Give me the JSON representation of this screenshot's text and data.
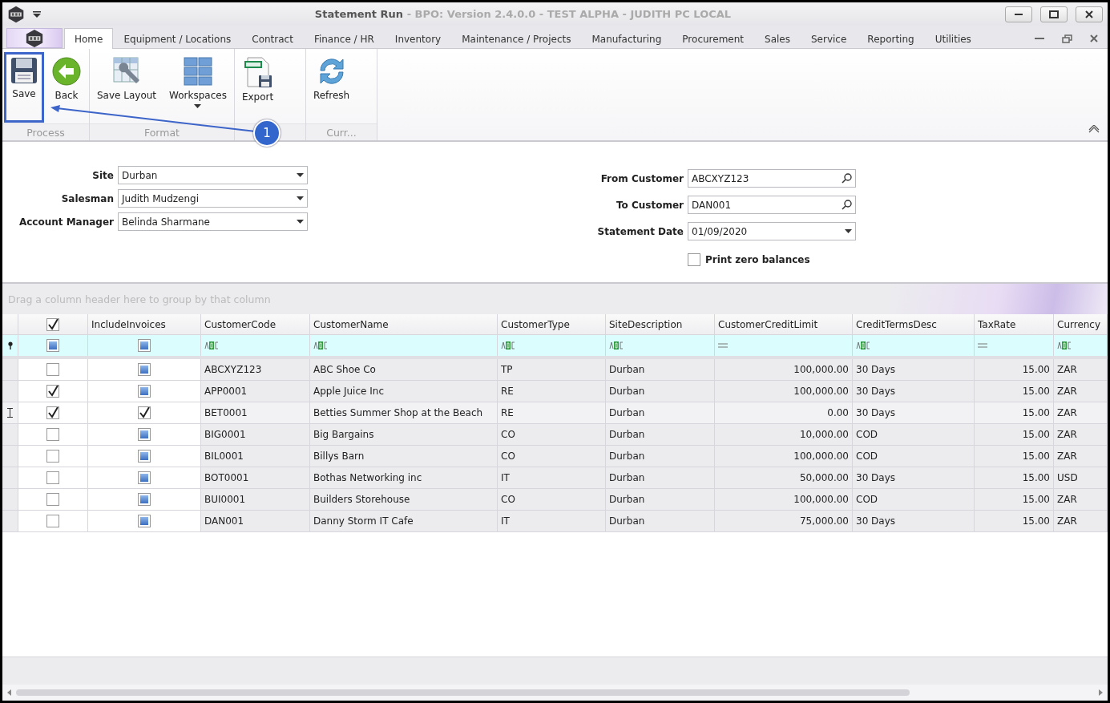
{
  "window": {
    "title": "Statement Run",
    "subtitle": " - BPO: Version 2.4.0.0 - TEST ALPHA - JUDITH PC LOCAL"
  },
  "tabs": [
    {
      "label": "Home",
      "selected": true
    },
    {
      "label": "Equipment / Locations",
      "selected": false
    },
    {
      "label": "Contract",
      "selected": false
    },
    {
      "label": "Finance / HR",
      "selected": false
    },
    {
      "label": "Inventory",
      "selected": false
    },
    {
      "label": "Maintenance / Projects",
      "selected": false
    },
    {
      "label": "Manufacturing",
      "selected": false
    },
    {
      "label": "Procurement",
      "selected": false
    },
    {
      "label": "Sales",
      "selected": false
    },
    {
      "label": "Service",
      "selected": false
    },
    {
      "label": "Reporting",
      "selected": false
    },
    {
      "label": "Utilities",
      "selected": false
    }
  ],
  "ribbon_groups": [
    {
      "label": "Process",
      "buttons": [
        {
          "label": "Save",
          "kind": "save",
          "highlighted": true
        },
        {
          "label": "Back",
          "kind": "back",
          "highlighted": false
        }
      ]
    },
    {
      "label": "Format",
      "buttons": [
        {
          "label": "Save Layout",
          "kind": "layout",
          "highlighted": false
        },
        {
          "label": "Workspaces",
          "kind": "workspaces",
          "highlighted": false,
          "dropdown": true
        }
      ]
    },
    {
      "buttons": [
        {
          "label": "Export",
          "kind": "export",
          "highlighted": false
        }
      ]
    },
    {
      "label": "Curr...",
      "buttons": [
        {
          "label": "Refresh",
          "kind": "refresh",
          "highlighted": false
        }
      ]
    }
  ],
  "callout": {
    "number": "1"
  },
  "filters_left": [
    {
      "label": "Site",
      "value": "Durban",
      "kind": "dropdown"
    },
    {
      "label": "Salesman",
      "value": "Judith Mudzengi",
      "kind": "dropdown"
    },
    {
      "label": "Account Manager",
      "value": "Belinda Sharmane",
      "kind": "dropdown"
    }
  ],
  "filters_right": [
    {
      "label": "From Customer",
      "value": "ABCXYZ123",
      "kind": "lookup"
    },
    {
      "label": "To Customer",
      "value": "DAN001",
      "kind": "lookup"
    },
    {
      "label": "Statement Date",
      "value": "01/09/2020",
      "kind": "dropdown"
    }
  ],
  "print_zero_balances": {
    "label": "Print zero balances",
    "checked": false
  },
  "grid": {
    "group_panel": "Drag a column header here to group by that column",
    "select_all_checked": true,
    "select_filter_indeterminate": true,
    "include_column": {
      "label": "IncludeInvoices",
      "filter_indeterminate": true
    },
    "columns": [
      {
        "label": "CustomerCode",
        "kind": "text"
      },
      {
        "label": "CustomerName",
        "kind": "text"
      },
      {
        "label": "CustomerType",
        "kind": "text"
      },
      {
        "label": "SiteDescription",
        "kind": "text"
      },
      {
        "label": "CustomerCreditLimit",
        "kind": "number"
      },
      {
        "label": "CreditTermsDesc",
        "kind": "text"
      },
      {
        "label": "TaxRate",
        "kind": "number"
      },
      {
        "label": "Currency",
        "kind": "text"
      }
    ],
    "rows": [
      {
        "checked": false,
        "include_checked": false,
        "focused": false,
        "cells": [
          "ABCXYZ123",
          "ABC Shoe Co",
          "TP",
          "Durban",
          "100,000.00",
          "30 Days",
          "15.00",
          "ZAR"
        ]
      },
      {
        "checked": true,
        "include_checked": false,
        "focused": false,
        "cells": [
          "APP0001",
          "Apple Juice Inc",
          "RE",
          "Durban",
          "100,000.00",
          "30 Days",
          "15.00",
          "ZAR"
        ]
      },
      {
        "checked": true,
        "include_checked": true,
        "focused": true,
        "cells": [
          "BET0001",
          "Betties Summer Shop at the Beach",
          "RE",
          "Durban",
          "0.00",
          "30 Days",
          "15.00",
          "ZAR"
        ]
      },
      {
        "checked": false,
        "include_checked": false,
        "focused": false,
        "cells": [
          "BIG0001",
          "Big Bargains",
          "CO",
          "Durban",
          "10,000.00",
          "COD",
          "15.00",
          "ZAR"
        ]
      },
      {
        "checked": false,
        "include_checked": false,
        "focused": false,
        "cells": [
          "BIL0001",
          "Billys Barn",
          "CO",
          "Durban",
          "100,000.00",
          "COD",
          "15.00",
          "ZAR"
        ]
      },
      {
        "checked": false,
        "include_checked": false,
        "focused": false,
        "cells": [
          "BOT0001",
          "Bothas Networking inc",
          "IT",
          "Durban",
          "50,000.00",
          "30 Days",
          "15.00",
          "USD"
        ]
      },
      {
        "checked": false,
        "include_checked": false,
        "focused": false,
        "cells": [
          "BUI0001",
          "Builders Storehouse",
          "CO",
          "Durban",
          "100,000.00",
          "COD",
          "15.00",
          "ZAR"
        ]
      },
      {
        "checked": false,
        "include_checked": false,
        "focused": false,
        "cells": [
          "DAN001",
          "Danny Storm IT Cafe",
          "IT",
          "Durban",
          "75,000.00",
          "30 Days",
          "15.00",
          "ZAR"
        ]
      }
    ]
  }
}
